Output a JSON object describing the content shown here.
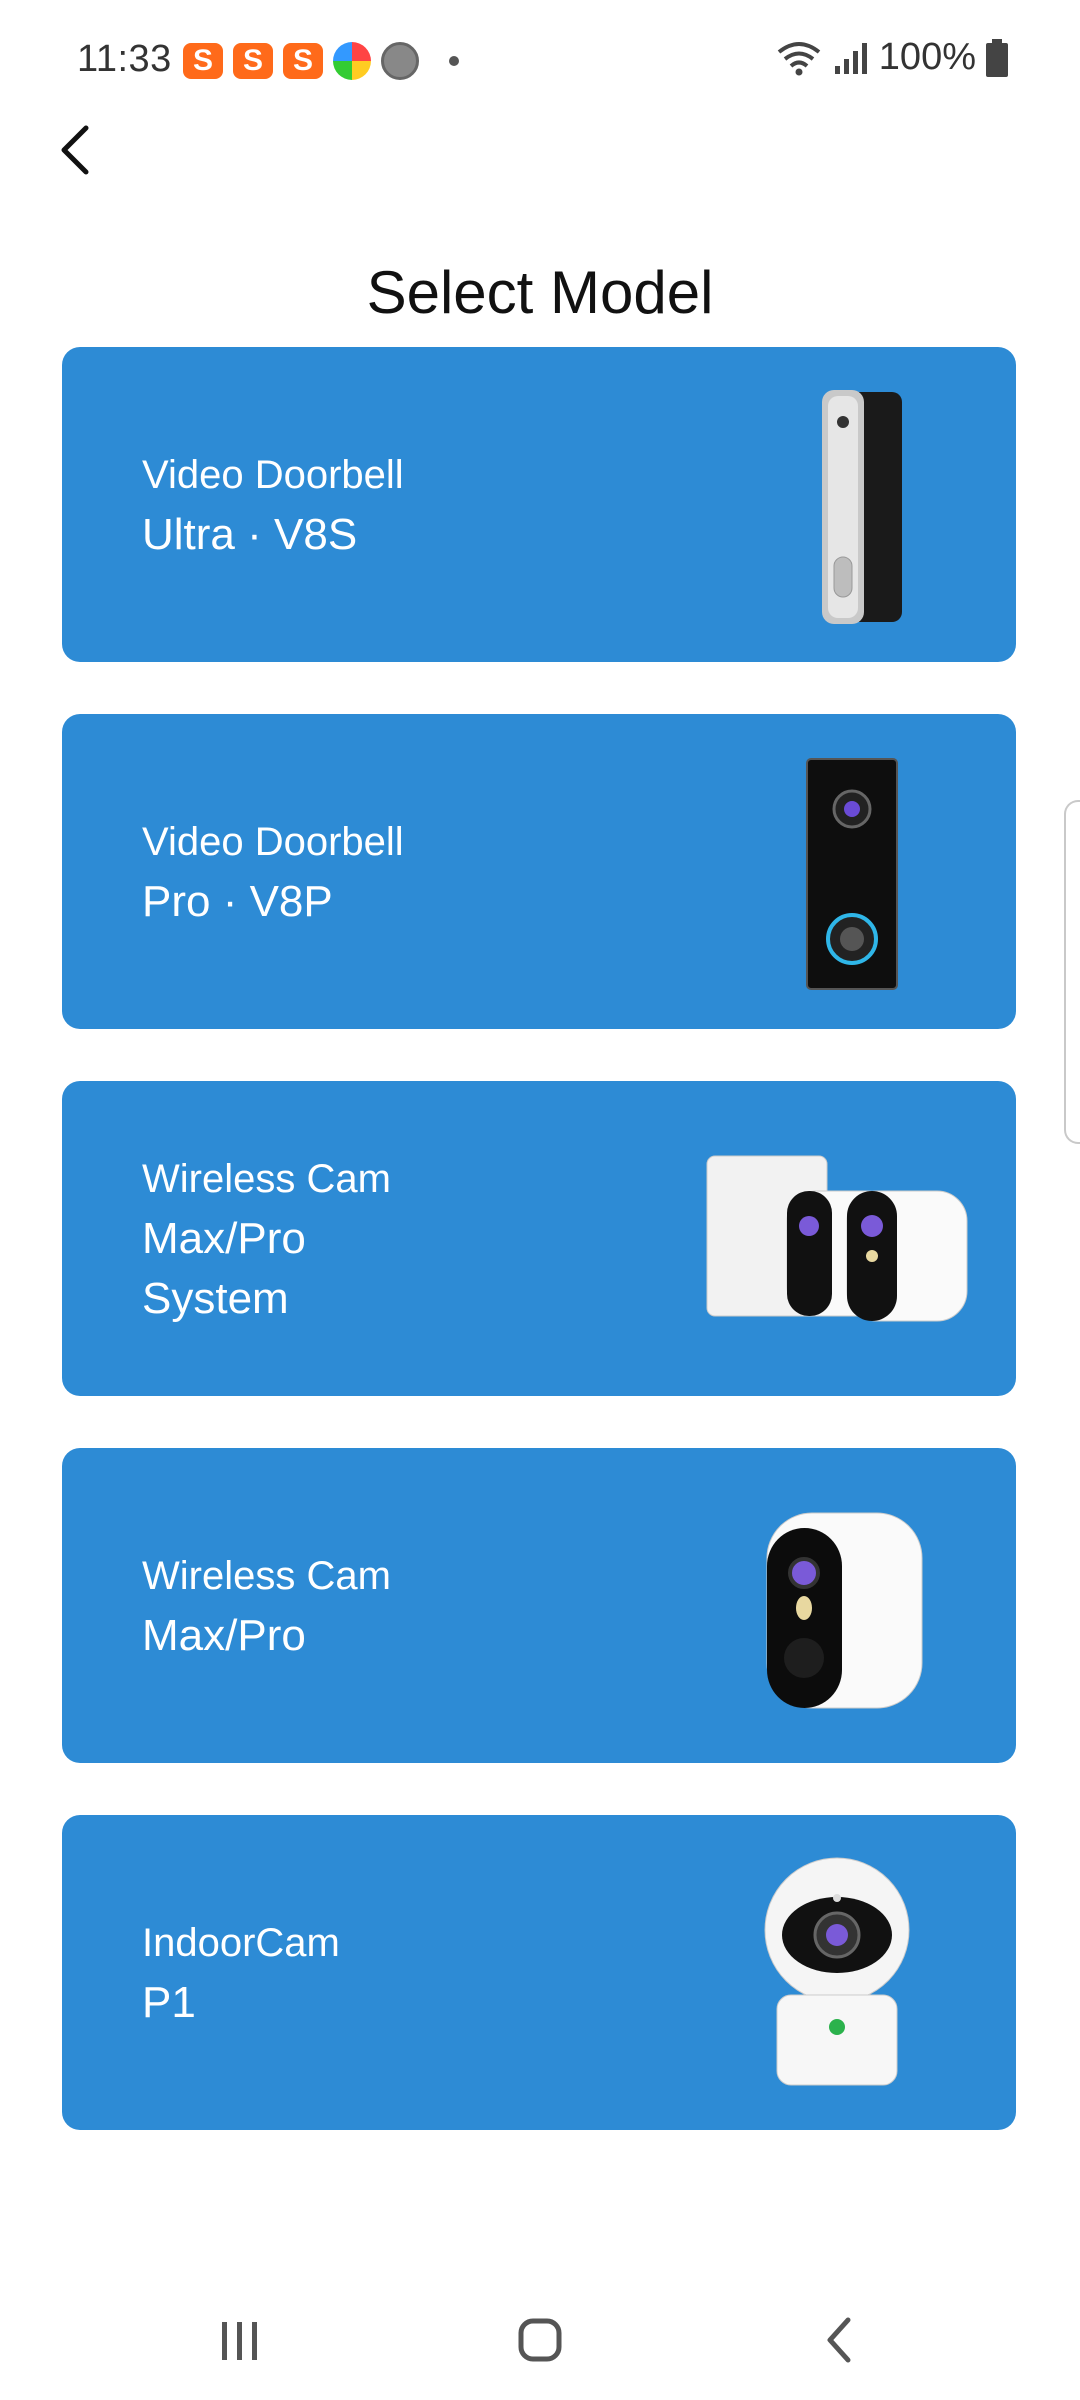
{
  "status_bar": {
    "time": "11:33",
    "battery": "100%",
    "notification_icons": [
      "s-app-icon",
      "s-app-icon",
      "s-app-icon",
      "browser-icon",
      "game-icon"
    ]
  },
  "header": {
    "title": "Select Model"
  },
  "models": [
    {
      "series": "Video Doorbell",
      "model": "Ultra · V8S",
      "image": "doorbell-ultra-image"
    },
    {
      "series": "Video Doorbell",
      "model": "Pro · V8P",
      "image": "doorbell-pro-image"
    },
    {
      "series": "Wireless Cam",
      "model": "Max/Pro\nSystem",
      "image": "camera-system-image"
    },
    {
      "series": "Wireless Cam",
      "model": "Max/Pro",
      "image": "wireless-cam-image"
    },
    {
      "series": "IndoorCam",
      "model": "P1",
      "image": "indoor-cam-image"
    }
  ],
  "colors": {
    "card_bg": "#2d8bd5",
    "text_on_card": "#ffffff",
    "status_s_icon": "#ff6a1a"
  }
}
